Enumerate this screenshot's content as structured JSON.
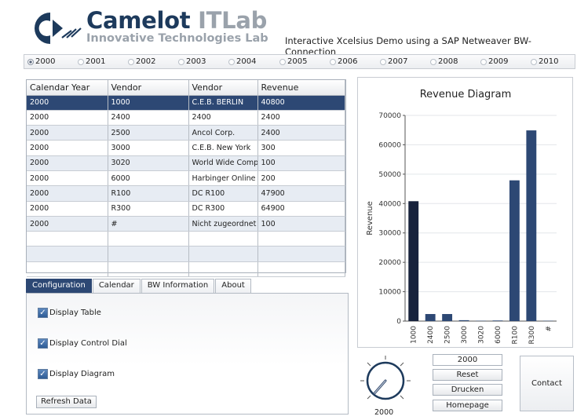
{
  "header": {
    "brand_main": "Camelot ",
    "brand_accent": "ITLab",
    "brand_sub": "Innovative Technologies Lab",
    "demo_title": "Interactive Xcelsius Demo using a SAP Netweaver BW-Connection",
    "brand_color": "#1d3a5c",
    "accent_color": "#9aa2ab"
  },
  "years": {
    "selected": "2000",
    "items": [
      "2000",
      "2001",
      "2002",
      "2003",
      "2004",
      "2005",
      "2006",
      "2007",
      "2008",
      "2009",
      "2010"
    ]
  },
  "table": {
    "headers": [
      "Calendar Year",
      "Vendor",
      "Vendor",
      "Revenue"
    ],
    "rows": [
      [
        "2000",
        "1000",
        "C.E.B. BERLIN",
        "40800"
      ],
      [
        "2000",
        "2400",
        "2400",
        "2400"
      ],
      [
        "2000",
        "2500",
        "Ancol Corp.",
        "2400"
      ],
      [
        "2000",
        "3000",
        "C.E.B. New York",
        "300"
      ],
      [
        "2000",
        "3020",
        "World Wide Comp",
        "100"
      ],
      [
        "2000",
        "6000",
        "Harbinger Online",
        "200"
      ],
      [
        "2000",
        "R100",
        "DC R100",
        "47900"
      ],
      [
        "2000",
        "R300",
        "DC R300",
        "64900"
      ],
      [
        "2000",
        "#",
        "Nicht zugeordnet",
        "100"
      ],
      [
        "",
        "",
        "",
        ""
      ],
      [
        "",
        "",
        "",
        ""
      ],
      [
        "",
        "",
        "",
        ""
      ]
    ],
    "selected_row_color": "#2d4874"
  },
  "tabs": {
    "items": [
      "Configuration",
      "Calendar",
      "BW Information",
      "About"
    ],
    "active": "Configuration"
  },
  "config": {
    "display_table": "Display Table",
    "display_dial": "Display Control Dial",
    "display_diagram": "Display Diagram",
    "refresh": "Refresh Data",
    "checked": true
  },
  "controls": {
    "year_field": "2000",
    "reset": "Reset",
    "print": "Drucken",
    "homepage": "Homepage",
    "contact": "Contact",
    "dial_value": "2000"
  },
  "chart_data": {
    "type": "bar",
    "title": "Revenue Diagram",
    "ylabel": "Revenue",
    "xlabel": "",
    "categories": [
      "1000",
      "2400",
      "2500",
      "3000",
      "3020",
      "6000",
      "R100",
      "R300",
      "#"
    ],
    "values": [
      40800,
      2400,
      2400,
      300,
      100,
      200,
      47900,
      64900,
      100
    ],
    "ylim": [
      0,
      70000
    ],
    "yticks": [
      0,
      10000,
      20000,
      30000,
      40000,
      50000,
      60000,
      70000
    ],
    "bar_colors": [
      "#17223c",
      "#2d4874"
    ],
    "grid": true
  }
}
